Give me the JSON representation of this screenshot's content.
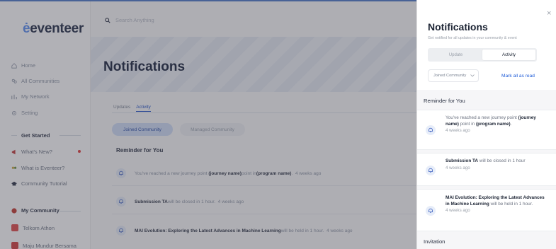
{
  "app": {
    "logo": "eventeer",
    "logo_mark": "ė",
    "search_placeholder": "Search Anything",
    "nav": [
      {
        "label": "Home",
        "icon": "home-icon"
      },
      {
        "label": "All Communities",
        "icon": "communities-icon"
      },
      {
        "label": "My Network",
        "icon": "network-icon"
      },
      {
        "label": "Setting",
        "icon": "gear-icon"
      }
    ],
    "get_started": "Get Started",
    "help_items": [
      {
        "label": "What's New?",
        "icon": "megaphone-icon"
      },
      {
        "label": "What is Eventeer?",
        "icon": "people-icon"
      },
      {
        "label": "Community Tutorial",
        "icon": "grad-cap-icon"
      }
    ],
    "my_community": "My Community",
    "communities": [
      {
        "label": "Telkom Athon",
        "color": "#e04848"
      },
      {
        "label": "Maju Mundur Bersama",
        "color": "#d23c3c"
      }
    ],
    "page_title": "Notifications",
    "tabs": [
      "Updates",
      "Activity"
    ],
    "pills": [
      "Joined Community",
      "Managed Community"
    ],
    "section_heading": "Reminder for You",
    "feed": [
      {
        "pre": "You've reached a new journey point ",
        "b1": "(journey name)",
        "mid": " point in ",
        "b2": "(program name)",
        "post": ".",
        "ago": "4 weeks ago"
      },
      {
        "pre": "",
        "b1": "Submission TA",
        "mid": " will be closed in 1 hour.",
        "b2": "",
        "post": "",
        "ago": "4 weeks ago"
      },
      {
        "pre": "",
        "b1": "MAI Evolution: Exploring the Latest Advances in Machine Learning",
        "mid": " will be held in 1 hour.",
        "b2": "",
        "post": "",
        "ago": "4 weeks ago"
      }
    ]
  },
  "drawer": {
    "title": "Notifications",
    "subtitle": "Get notified for all updates in your community & event",
    "segments": [
      "Update",
      "Activity"
    ],
    "filter_value": "Joined Community",
    "mark_all": "Mark all as read",
    "close_symbol": "×",
    "reminder_heading": "Reminder for You",
    "items": [
      {
        "pre": "You've reached a new journey point ",
        "b1": "(journey name)",
        "mid": " point in ",
        "b2": "(program name)",
        "post": ".",
        "ago": "4 weeks ago"
      },
      {
        "pre": "",
        "b1": "Submission TA",
        "mid": " will be closed in 1 hour",
        "b2": "",
        "post": "",
        "ago": "4 weeks ago"
      },
      {
        "pre": "",
        "b1": "MAI Evolution: Exploring the Latest Advances in Machine Learning",
        "mid": " will be held in 1 hour.",
        "b2": "",
        "post": "",
        "ago": "4 weeks ago"
      }
    ],
    "invitation_heading": "Invitation"
  },
  "colors": {
    "accent": "#1d5bd8",
    "brand_dark": "#1f2a44",
    "overlay": "rgba(70,70,80,0.42)",
    "notification_dot": "#e03838"
  }
}
